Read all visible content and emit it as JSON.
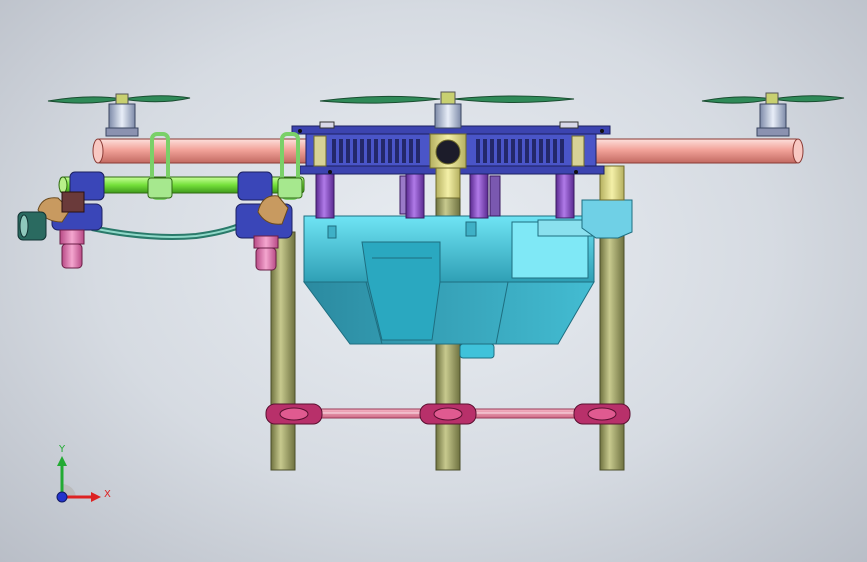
{
  "view": {
    "background_top": "#e9edf2",
    "background_bottom": "#b9bec7"
  },
  "triad": {
    "y_label": "Y",
    "x_label": "X",
    "y_color": "#22aa33",
    "x_color": "#dd2222",
    "z_color": "#2233cc"
  },
  "colors": {
    "arm": "#f2a39a",
    "arm_dark": "#c26a62",
    "pipe_green": "#74e03a",
    "frame_blue": "#4a55c8",
    "frame_dark": "#2a2f7a",
    "tank_cyan": "#58d6ea",
    "tank_dark": "#2f9fb5",
    "leg_olive": "#a6a86a",
    "leg_dark": "#6f7240",
    "rotor_green": "#2f8a58",
    "clamp_magenta": "#b8306a",
    "strut_purple": "#8a45c8",
    "nozzle_pink": "#e07ab0",
    "nozzle_brown": "#b88a55"
  }
}
